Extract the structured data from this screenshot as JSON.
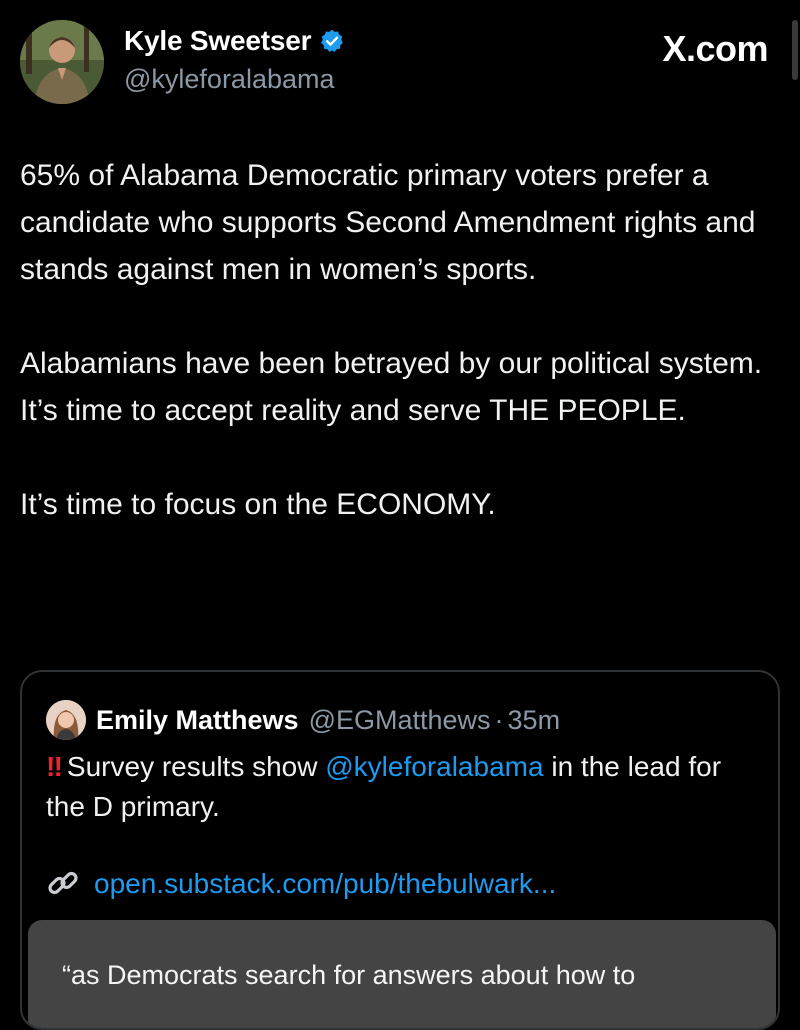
{
  "author": {
    "display_name": "Kyle Sweetser",
    "handle": "@kyleforalabama",
    "verified": true
  },
  "site_label": "X.com",
  "tweet": {
    "paragraphs": [
      "65% of Alabama Democratic primary voters prefer a candidate who supports Second Amendment rights and stands against men in women’s sports.",
      "Alabamians have been betrayed by our political system. It’s time to accept reality and serve THE PEOPLE.",
      "It’s time to focus on the ECONOMY."
    ]
  },
  "quote": {
    "display_name": "Emily Matthews",
    "handle": "@EGMatthews",
    "separator": "·",
    "time": "35m",
    "emoji": "‼",
    "text_before": "Survey results show",
    "mention": "@kyleforalabama",
    "text_after": "in the lead for the D primary.",
    "link_emoji": "🔗",
    "link": "open.substack.com/pub/thebulwark...",
    "preview_text": "“as Democrats search for answers about how to"
  },
  "colors": {
    "background": "#000000",
    "text": "#e7e9ea",
    "secondary": "#8b98a5",
    "link": "#1d9bf0",
    "verified": "#1d9bf0",
    "alert": "#f4212e"
  }
}
